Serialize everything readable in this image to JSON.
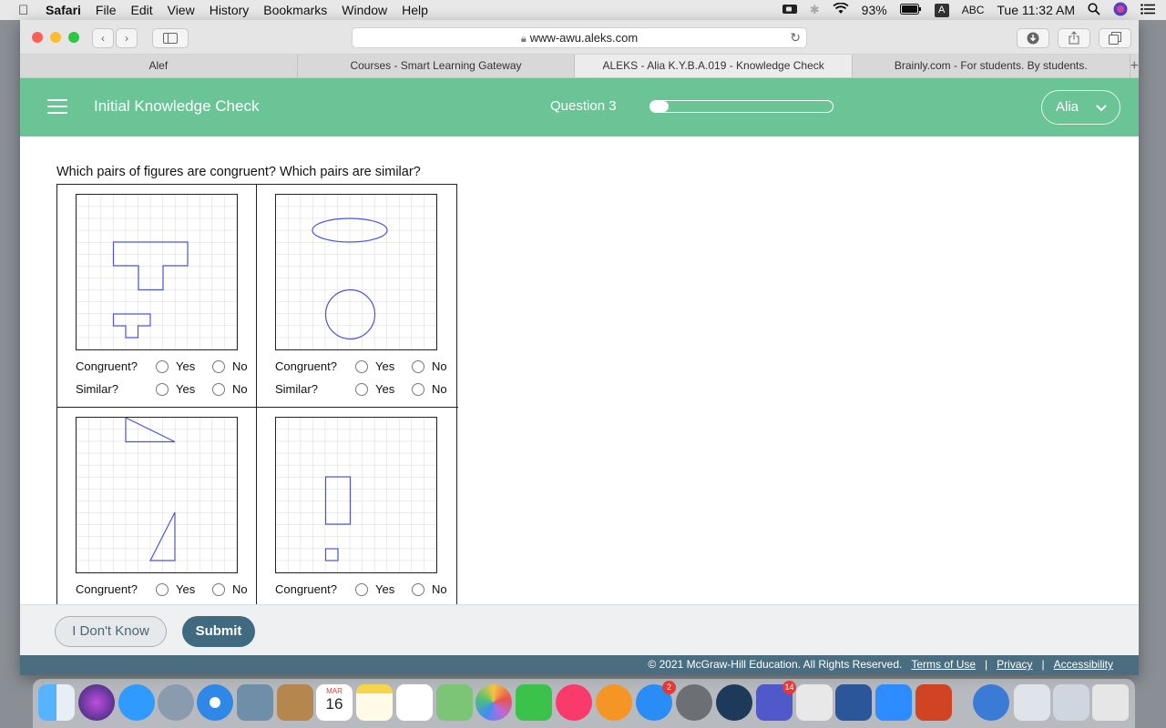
{
  "menubar": {
    "app": "Safari",
    "items": [
      "File",
      "Edit",
      "View",
      "History",
      "Bookmarks",
      "Window",
      "Help"
    ],
    "battery": "93%",
    "input": "ABC",
    "input_letter": "A",
    "clock": "Tue 11:32 AM"
  },
  "browser": {
    "url": "www-awu.aleks.com",
    "tabs": [
      {
        "label": "Alef"
      },
      {
        "label": "Courses - Smart Learning Gateway"
      },
      {
        "label": "ALEKS - Alia K.Y.B.A.019 - Knowledge Check"
      },
      {
        "label": "Brainly.com - For students. By students."
      }
    ]
  },
  "header": {
    "title": "Initial Knowledge Check",
    "question_label": "Question 3",
    "progress_fraction": 0.1,
    "user": "Alia"
  },
  "question": {
    "prompt": "Which pairs of figures are congruent? Which pairs are similar?",
    "congruent_label": "Congruent?",
    "similar_label": "Similar?",
    "yes_label": "Yes",
    "no_label": "No"
  },
  "footer": {
    "idk_label": "I Don't Know",
    "submit_label": "Submit",
    "copyright": "© 2021 McGraw-Hill Education. All Rights Reserved.",
    "links": [
      "Terms of Use",
      "Privacy",
      "Accessibility"
    ]
  },
  "dock": {
    "calendar_month": "MAR",
    "calendar_day": "16",
    "appstore_badge": "2",
    "teams_badge": "14"
  },
  "colors": {
    "header_green": "#6ac496",
    "submit_blue": "#3f6a80",
    "figure_stroke": "#4a55d6"
  }
}
